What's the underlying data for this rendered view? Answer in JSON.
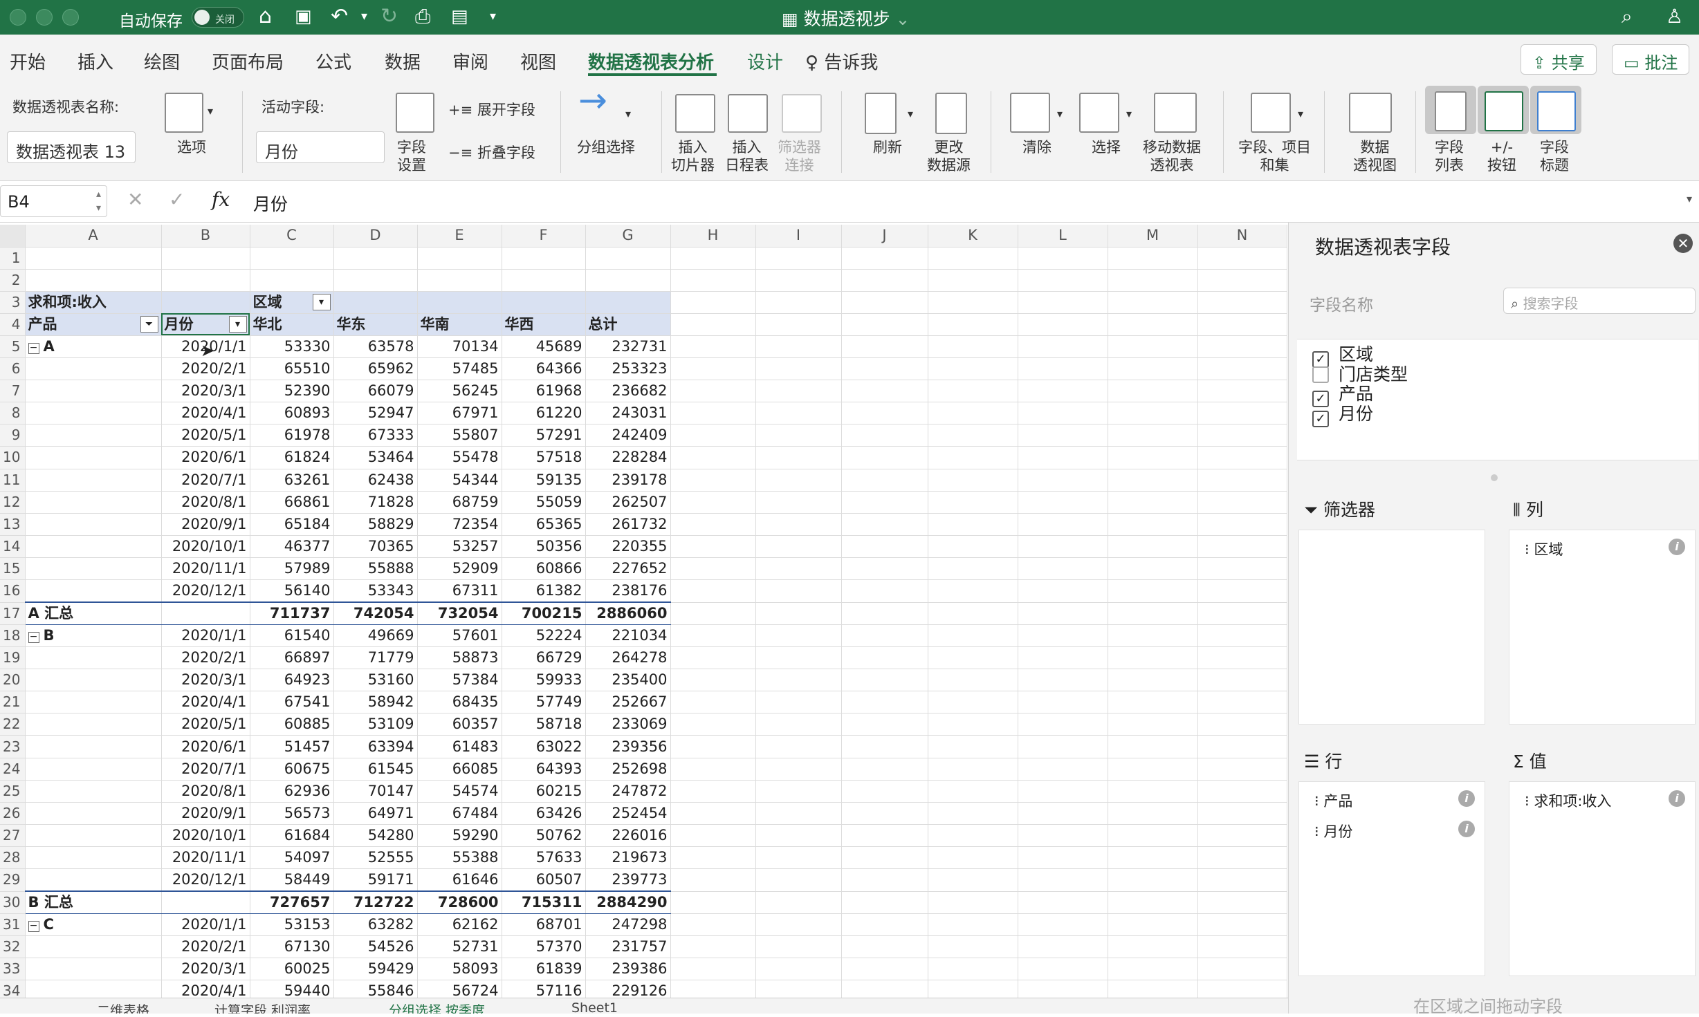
{
  "titlebar": {
    "autosave_label": "自动保存",
    "toggle_state": "关闭",
    "document_title": "数据透视步"
  },
  "tabs": [
    "开始",
    "插入",
    "绘图",
    "页面布局",
    "公式",
    "数据",
    "审阅",
    "视图",
    "数据透视表分析",
    "设计"
  ],
  "active_tab": "数据透视表分析",
  "tell_me": "告诉我",
  "share_label": "共享",
  "comment_label": "批注",
  "ribbon": {
    "pivot_name_label": "数据透视表名称:",
    "pivot_name_value": "数据透视表 13",
    "options_label": "选项",
    "active_field_label": "活动字段:",
    "active_field_value": "月份",
    "field_settings_label": [
      "字段",
      "设置"
    ],
    "expand_field_label": "展开字段",
    "collapse_field_label": "折叠字段",
    "group_selection_label": "分组选择",
    "insert_slicer_label": [
      "插入",
      "切片器"
    ],
    "insert_timeline_label": [
      "插入",
      "日程表"
    ],
    "filter_connections_label": [
      "筛选器",
      "连接"
    ],
    "refresh_label": "刷新",
    "change_source_label": [
      "更改",
      "数据源"
    ],
    "clear_label": "清除",
    "select_label": "选择",
    "move_pivot_label": [
      "移动数据",
      "透视表"
    ],
    "fields_items_label": [
      "字段、项目",
      "和集"
    ],
    "pivot_chart_label": [
      "数据",
      "透视图"
    ],
    "field_list_label": [
      "字段",
      "列表"
    ],
    "plus_minus_label": [
      "+/-",
      "按钮"
    ],
    "field_headers_label": [
      "字段",
      "标题"
    ]
  },
  "formula_bar": {
    "cell_ref": "B4",
    "fx": "fx",
    "content": "月份"
  },
  "columns": [
    "A",
    "B",
    "C",
    "D",
    "E",
    "F",
    "G",
    "H",
    "I",
    "J",
    "K",
    "L",
    "M",
    "N"
  ],
  "pivot": {
    "values_header": "求和项:收入",
    "col_field": "区域",
    "row_field_product": "产品",
    "row_field_month": "月份",
    "regions": [
      "华北",
      "华东",
      "华南",
      "华西"
    ],
    "total_label": "总计",
    "groups": [
      {
        "name": "A",
        "subtotal_label": "A 汇总",
        "rows": [
          [
            "2020/1/1",
            53330,
            63578,
            70134,
            45689,
            232731
          ],
          [
            "2020/2/1",
            65510,
            65962,
            57485,
            64366,
            253323
          ],
          [
            "2020/3/1",
            52390,
            66079,
            56245,
            61968,
            236682
          ],
          [
            "2020/4/1",
            60893,
            52947,
            67971,
            61220,
            243031
          ],
          [
            "2020/5/1",
            61978,
            67333,
            55807,
            57291,
            242409
          ],
          [
            "2020/6/1",
            61824,
            53464,
            55478,
            57518,
            228284
          ],
          [
            "2020/7/1",
            63261,
            62438,
            54344,
            59135,
            239178
          ],
          [
            "2020/8/1",
            66861,
            71828,
            68759,
            55059,
            262507
          ],
          [
            "2020/9/1",
            65184,
            58829,
            72354,
            65365,
            261732
          ],
          [
            "2020/10/1",
            46377,
            70365,
            53257,
            50356,
            220355
          ],
          [
            "2020/11/1",
            57989,
            55888,
            52909,
            60866,
            227652
          ],
          [
            "2020/12/1",
            56140,
            53343,
            67311,
            61382,
            238176
          ]
        ],
        "subtotal": [
          711737,
          742054,
          732054,
          700215,
          2886060
        ]
      },
      {
        "name": "B",
        "subtotal_label": "B 汇总",
        "rows": [
          [
            "2020/1/1",
            61540,
            49669,
            57601,
            52224,
            221034
          ],
          [
            "2020/2/1",
            66897,
            71779,
            58873,
            66729,
            264278
          ],
          [
            "2020/3/1",
            64923,
            53160,
            57384,
            59933,
            235400
          ],
          [
            "2020/4/1",
            67541,
            58942,
            68435,
            57749,
            252667
          ],
          [
            "2020/5/1",
            60885,
            53109,
            60357,
            58718,
            233069
          ],
          [
            "2020/6/1",
            51457,
            63394,
            61483,
            63022,
            239356
          ],
          [
            "2020/7/1",
            60675,
            61545,
            66085,
            64393,
            252698
          ],
          [
            "2020/8/1",
            62936,
            70147,
            54574,
            60215,
            247872
          ],
          [
            "2020/9/1",
            56573,
            64971,
            67484,
            63426,
            252454
          ],
          [
            "2020/10/1",
            61684,
            54280,
            59290,
            50762,
            226016
          ],
          [
            "2020/11/1",
            54097,
            52555,
            55388,
            57633,
            219673
          ],
          [
            "2020/12/1",
            58449,
            59171,
            61646,
            60507,
            239773
          ]
        ],
        "subtotal": [
          727657,
          712722,
          728600,
          715311,
          2884290
        ]
      },
      {
        "name": "C",
        "rows": [
          [
            "2020/1/1",
            53153,
            63282,
            62162,
            68701,
            247298
          ],
          [
            "2020/2/1",
            67130,
            54526,
            52731,
            57370,
            231757
          ],
          [
            "2020/3/1",
            60025,
            59429,
            58093,
            61839,
            239386
          ],
          [
            "2020/4/1",
            59440,
            55846,
            56724,
            57116,
            229126
          ]
        ]
      }
    ]
  },
  "sheet_tabs": [
    "二维表格",
    "计算字段 利润率",
    "分组选择 按季度",
    "Sheet1"
  ],
  "active_sheet": "分组选择 按季度",
  "panel": {
    "title": "数据透视表字段",
    "field_name_label": "字段名称",
    "search_placeholder": "搜索字段",
    "fields": [
      {
        "name": "区域",
        "checked": true
      },
      {
        "name": "门店类型",
        "checked": false
      },
      {
        "name": "产品",
        "checked": true
      },
      {
        "name": "月份",
        "checked": true
      }
    ],
    "filters_label": "筛选器",
    "columns_label": "列",
    "columns_items": [
      "区域"
    ],
    "rows_label": "行",
    "rows_items": [
      "产品",
      "月份"
    ],
    "values_label": "值",
    "values_items": [
      "求和项:收入"
    ],
    "drag_hint": "在区域之间拖动字段"
  }
}
